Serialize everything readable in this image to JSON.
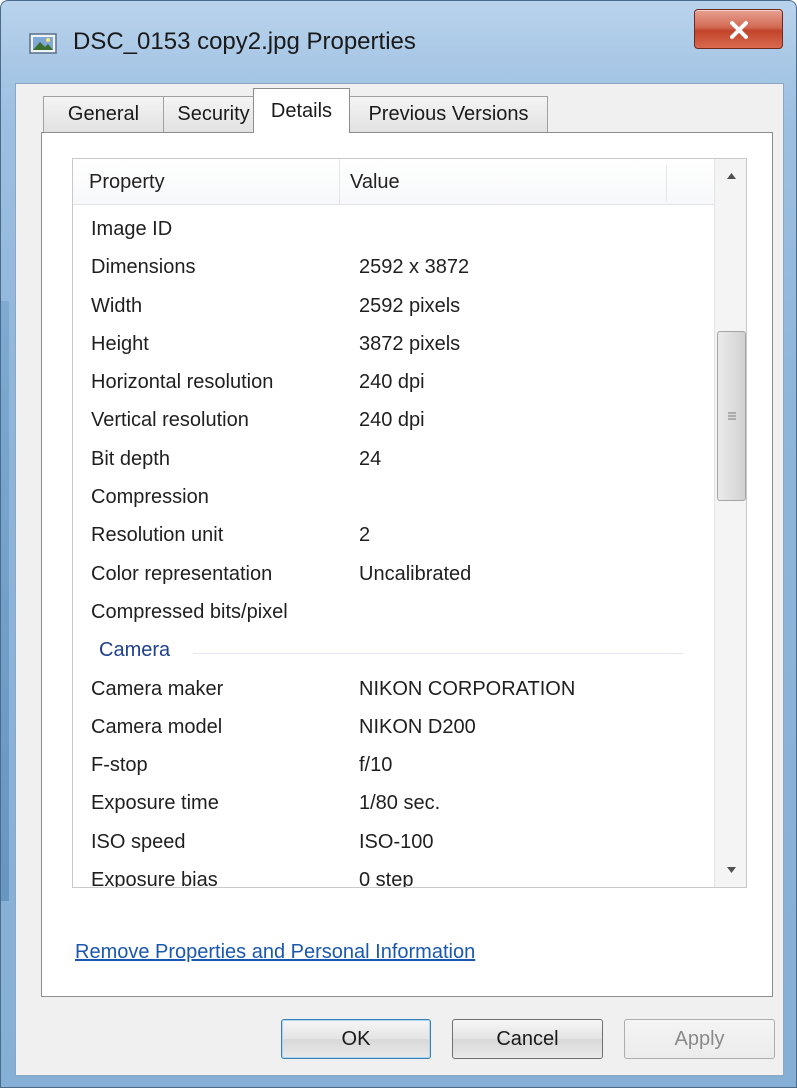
{
  "window": {
    "title": "DSC_0153 copy2.jpg Properties"
  },
  "tabs": [
    {
      "label": "General"
    },
    {
      "label": "Security"
    },
    {
      "label": "Details"
    },
    {
      "label": "Previous Versions"
    }
  ],
  "active_tab": "Details",
  "list": {
    "columns": {
      "property": "Property",
      "value": "Value"
    },
    "rows_top": [
      {
        "property": "Image ID",
        "value": ""
      },
      {
        "property": "Dimensions",
        "value": "2592 x 3872"
      },
      {
        "property": "Width",
        "value": "2592 pixels"
      },
      {
        "property": "Height",
        "value": "3872 pixels"
      },
      {
        "property": "Horizontal resolution",
        "value": "240 dpi"
      },
      {
        "property": "Vertical resolution",
        "value": "240 dpi"
      },
      {
        "property": "Bit depth",
        "value": "24"
      },
      {
        "property": "Compression",
        "value": ""
      },
      {
        "property": "Resolution unit",
        "value": "2"
      },
      {
        "property": "Color representation",
        "value": "Uncalibrated"
      },
      {
        "property": "Compressed bits/pixel",
        "value": ""
      }
    ],
    "group": "Camera",
    "rows_camera": [
      {
        "property": "Camera maker",
        "value": "NIKON CORPORATION"
      },
      {
        "property": "Camera model",
        "value": "NIKON D200"
      },
      {
        "property": "F-stop",
        "value": "f/10"
      },
      {
        "property": "Exposure time",
        "value": "1/80 sec."
      },
      {
        "property": "ISO speed",
        "value": "ISO-100"
      },
      {
        "property": "Exposure bias",
        "value": "0 step"
      }
    ]
  },
  "links": {
    "remove": "Remove Properties and Personal Information"
  },
  "buttons": {
    "ok": "OK",
    "cancel": "Cancel",
    "apply": "Apply",
    "apply_enabled": false
  },
  "icons": {
    "title": "image-file-icon",
    "close": "close-icon",
    "scroll_up": "scroll-up-arrow-icon",
    "scroll_down": "scroll-down-arrow-icon",
    "thumb_grip": "grip-icon"
  },
  "colors": {
    "link": "#1a58b0",
    "group_header": "#1e3f8a",
    "close_button": "#c2442a"
  }
}
